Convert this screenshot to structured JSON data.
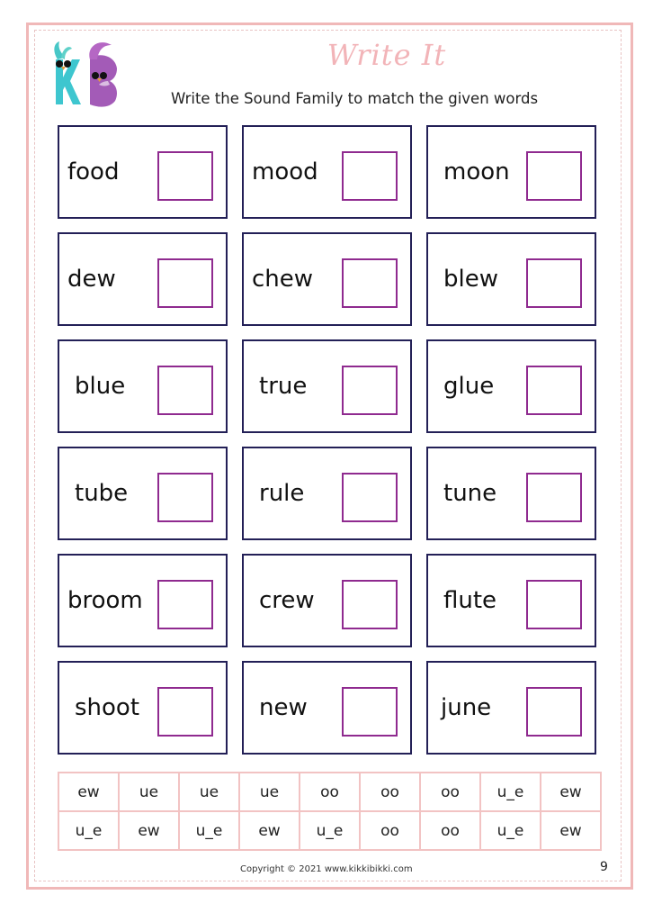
{
  "header": {
    "logo_text": "KB",
    "title": "Write It",
    "instruction": "Write the Sound Family to match the given words"
  },
  "cards": [
    {
      "word": "food"
    },
    {
      "word": "mood"
    },
    {
      "word": "moon"
    },
    {
      "word": "dew"
    },
    {
      "word": "chew"
    },
    {
      "word": "blew"
    },
    {
      "word": "blue"
    },
    {
      "word": "true"
    },
    {
      "word": "glue"
    },
    {
      "word": "tube"
    },
    {
      "word": "rule"
    },
    {
      "word": "tune"
    },
    {
      "word": "broom"
    },
    {
      "word": "crew"
    },
    {
      "word": "flute"
    },
    {
      "word": "shoot"
    },
    {
      "word": "new"
    },
    {
      "word": "june"
    }
  ],
  "word_bank": [
    [
      "ew",
      "ue",
      "ue",
      "ue",
      "oo",
      "oo",
      "oo",
      "u_e",
      "ew"
    ],
    [
      "u_e",
      "ew",
      "u_e",
      "ew",
      "u_e",
      "oo",
      "oo",
      "u_e",
      "ew"
    ]
  ],
  "footer": {
    "copyright": "Copyright © 2021 www.kikkibikki.com",
    "page_number": "9"
  },
  "colors": {
    "card_border": "#232057",
    "answer_box_border": "#8f2a8f",
    "title_pink": "#f2b4b8",
    "page_border": "#f0b8b8"
  }
}
